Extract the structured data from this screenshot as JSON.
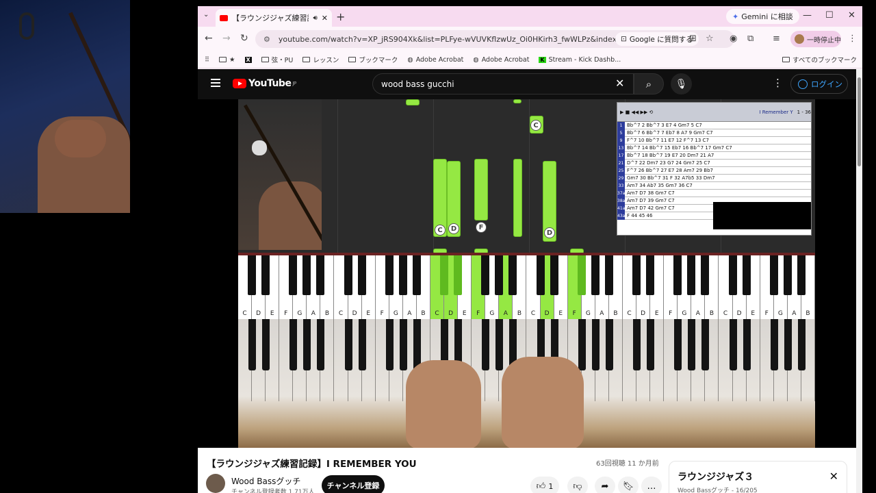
{
  "browser": {
    "tab_title": "【ラウンジジャズ練習記録】I RE",
    "gemini_label": "Gemini に相談",
    "url": "youtube.com/watch?v=XP_jRS904Xk&list=PLFye-wVUVKflzwUz_Oi0HKirh3_fwWLPz&index=16",
    "ask_google": "Google に質問する",
    "profile_label": "一時停止中",
    "bookmarks": [
      "★",
      "弦・PU",
      "レッスン",
      "ブックマーク",
      "Adobe Acrobat",
      "Adobe Acrobat",
      "Stream - Kick Dashb..."
    ],
    "all_bookmarks": "すべてのブックマーク"
  },
  "youtube": {
    "logo": "YouTube",
    "logo_region": "JP",
    "search_value": "wood bass gucchi",
    "login": "ログイン"
  },
  "video": {
    "sheet_song": "I Remember Y",
    "sheet_bar": "1 - 36",
    "sheet_rows": [
      [
        "1",
        "Bb^7   2 Bb^7   3 E7   4 Gm7  5 C7"
      ],
      [
        "5",
        "Bb^7   6 Bb^7   7 Eb7  8 A7   9 Gm7 C7"
      ],
      [
        "9",
        "F^7   10 Bb^7  11 E7  12 F^7  13 C7"
      ],
      [
        "13",
        "Bb^7  14 Bb^7  15 Eb7 16 Bb^7 17 Gm7 C7"
      ],
      [
        "17",
        "Bb^7  18 Bb^7  19 E7  20 Dm7  21 A7"
      ],
      [
        "21",
        "D^7   22 Dm7   23 G7  24 Gm7  25 C7"
      ],
      [
        "25",
        "F^7   26 Bb^7  27 E7  28 Am7  29 Bb7"
      ],
      [
        "29",
        "Gm7   30 Bb^7  31 F   32 A7b5 33 Dm7"
      ],
      [
        "33",
        "Am7   34 Ab7   35 Gm7 36 C7"
      ],
      [
        "37a",
        "Am7  D7   38 Gm7  C7"
      ],
      [
        "38a",
        "Am7  D7   39 Gm7  C7"
      ],
      [
        "41a",
        "Am7  D7   42 Gm7  C7"
      ],
      [
        "43a",
        "F    44   45   46"
      ]
    ],
    "falling_labels": [
      "C",
      "C",
      "D",
      "F",
      "D"
    ],
    "white_key_names": [
      "C",
      "D",
      "E",
      "F",
      "G",
      "A",
      "B"
    ],
    "highlight_white_indices": [
      14,
      15,
      17,
      19,
      22,
      24
    ],
    "highlight_black_indices": [
      10,
      11,
      17
    ]
  },
  "below": {
    "title": "【ラウンジジャズ練習記録】I REMEMBER YOU",
    "meta": "63回視聴  11 か月前",
    "channel": "Wood Bassグッチ",
    "subs": "チャンネル登録者数 1.71万人",
    "subscribe": "チャンネル登録",
    "likes": "1",
    "playlist_title": "ラウンジジャズ３",
    "playlist_sub": "Wood Bassグッチ - 16/205"
  }
}
